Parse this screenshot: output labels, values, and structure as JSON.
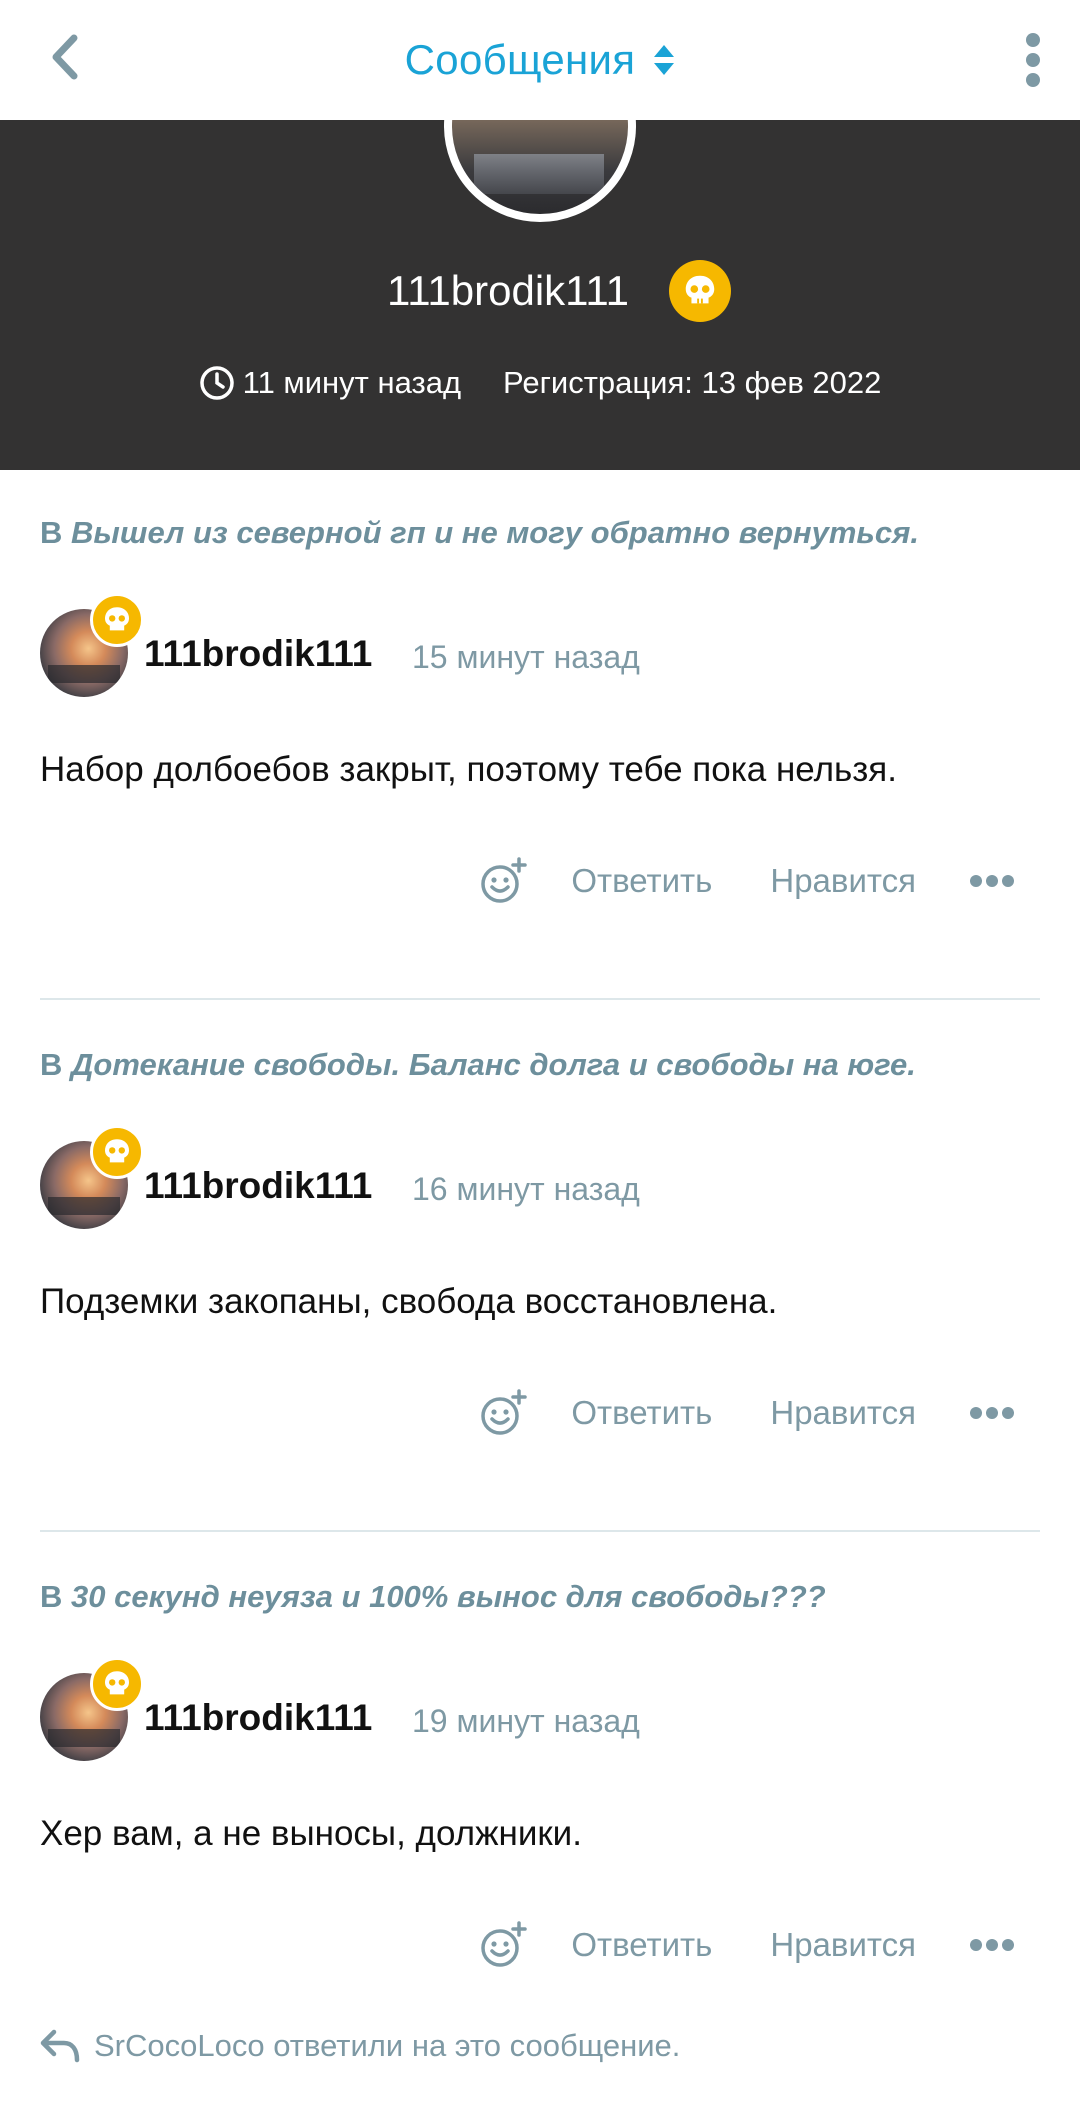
{
  "header": {
    "title": "Сообщения",
    "accent_color": "#1aa3d6"
  },
  "profile": {
    "username": "111brodik111",
    "last_seen": "11 минут назад",
    "registration": "Регистрация: 13 фев 2022",
    "badge_icon": "skull-icon",
    "badge_color": "#f6b800"
  },
  "posts": [
    {
      "prefix": "В",
      "topic": "Вышел из северной гп и не могу обратно вернуться.",
      "author": "111brodik111",
      "time": "15 минут назад",
      "text": "Набор долбоебов закрыт, поэтому тебе пока нельзя.",
      "reply_label": "Ответить",
      "like_label": "Нравится"
    },
    {
      "prefix": "В",
      "topic": "Дотекание свободы. Баланс долга и свободы на юге.",
      "author": "111brodik111",
      "time": "16 минут назад",
      "text": "Подземки закопаны, свобода восстановлена.",
      "reply_label": "Ответить",
      "like_label": "Нравится"
    },
    {
      "prefix": "В",
      "topic": "30 секунд неуяза и 100% вынос для свободы???",
      "author": "111brodik111",
      "time": "19 минут назад",
      "text": "Хер вам, а не выносы, должники.",
      "reply_label": "Ответить",
      "like_label": "Нравится"
    }
  ],
  "replied_note": "SrCocoLoco ответили на это сообщение."
}
